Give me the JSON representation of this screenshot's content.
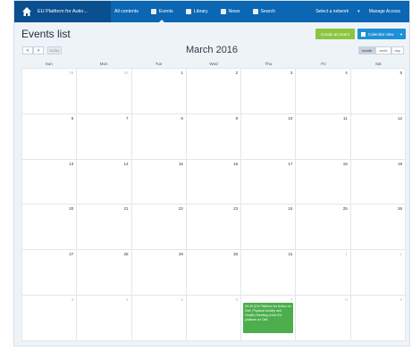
{
  "nav": {
    "brand": "EU Platform for Autio...",
    "items": [
      {
        "label": "All contents"
      },
      {
        "label": "Events"
      },
      {
        "label": "Library"
      },
      {
        "label": "News"
      },
      {
        "label": "Search"
      }
    ],
    "select_network": "Select a network",
    "manage_access": "Manage Access"
  },
  "page": {
    "title": "Events list",
    "create_button": "Create an event",
    "calendar_view_button": "Calendar view"
  },
  "calendar": {
    "month_title": "March 2016",
    "today_label": "today",
    "views": [
      "month",
      "week",
      "day"
    ],
    "days_of_week": [
      "Sun",
      "Mon",
      "Tue",
      "Wed",
      "Thu",
      "Fri",
      "Sat"
    ],
    "weeks": [
      [
        "28",
        "29",
        "1",
        "2",
        "3",
        "4",
        "5"
      ],
      [
        "6",
        "7",
        "8",
        "9",
        "10",
        "11",
        "12"
      ],
      [
        "13",
        "14",
        "15",
        "16",
        "17",
        "18",
        "19"
      ],
      [
        "20",
        "21",
        "22",
        "23",
        "24",
        "25",
        "26"
      ],
      [
        "27",
        "28",
        "29",
        "30",
        "31",
        "1",
        "2"
      ],
      [
        "3",
        "4",
        "5",
        "6",
        "7",
        "8",
        "9"
      ]
    ],
    "event": {
      "text": "09:30 (EU Platform for Action on Diet, Physical Activity and Health) Meeting of the EU platform on Diet"
    }
  }
}
